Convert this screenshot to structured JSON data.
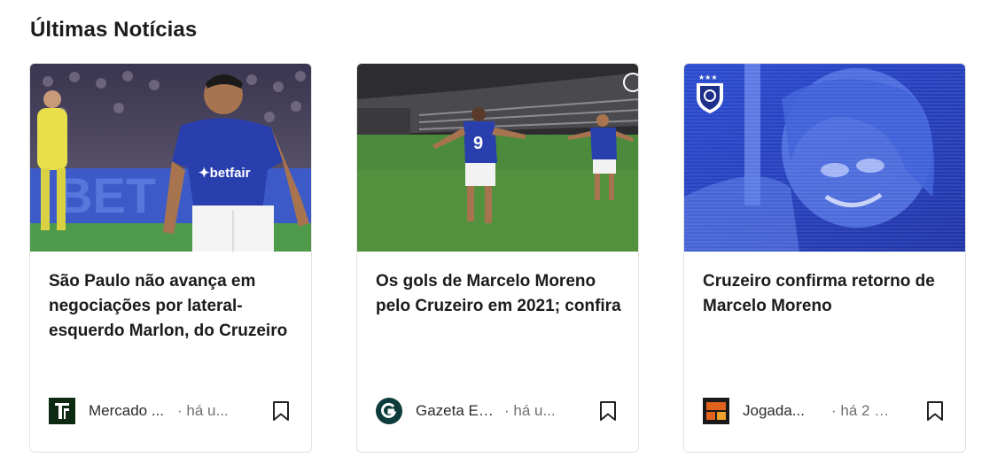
{
  "section": {
    "title": "Últimas Notícias"
  },
  "cards": [
    {
      "title": "São Paulo não avança em negociações por lateral-esquerdo Marlon, do Cruzeiro",
      "source": "Mercado ...",
      "time": "· há u...",
      "image": "soccer-player-cruzeiro-kit",
      "logo": "mercado-do-futebol-logo"
    },
    {
      "title": "Os gols de Marcelo Moreno pelo Cruzeiro em 2021; confira",
      "source": "Gazeta Es...",
      "time": "· há u...",
      "image": "players-celebrating-goal",
      "logo": "gazeta-esportiva-logo"
    },
    {
      "title": "Cruzeiro confirma retorno de Marcelo Moreno",
      "source": "Jogada...",
      "time": "· há 2 hor...",
      "image": "marcelo-moreno-blue-poster",
      "logo": "jogada-10-logo"
    }
  ],
  "colors": {
    "cruzeiro_blue": "#2a3fae",
    "text": "#1b1b1b",
    "muted": "#707070",
    "border": "#e2e2e2"
  }
}
